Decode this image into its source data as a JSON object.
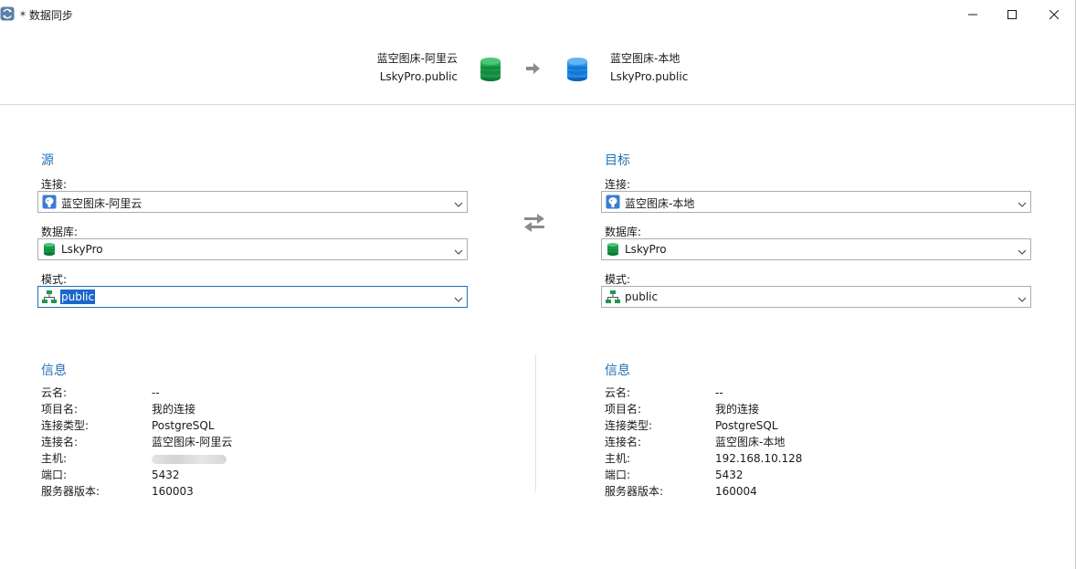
{
  "window": {
    "title": "* 数据同步"
  },
  "banner": {
    "source_line1": "蓝空图床-阿里云",
    "source_line2": "LskyPro.public",
    "target_line1": "蓝空图床-本地",
    "target_line2": "LskyPro.public"
  },
  "source": {
    "title": "源",
    "connection_label": "连接:",
    "connection_value": "蓝空图床-阿里云",
    "database_label": "数据库:",
    "database_value": "LskyPro",
    "schema_label": "模式:",
    "schema_value": "public"
  },
  "target": {
    "title": "目标",
    "connection_label": "连接:",
    "connection_value": "蓝空图床-本地",
    "database_label": "数据库:",
    "database_value": "LskyPro",
    "schema_label": "模式:",
    "schema_value": "public"
  },
  "source_info": {
    "title": "信息",
    "rows": [
      {
        "label": "云名:",
        "value": "--"
      },
      {
        "label": "项目名:",
        "value": "我的连接"
      },
      {
        "label": "连接类型:",
        "value": "PostgreSQL"
      },
      {
        "label": "连接名:",
        "value": "蓝空图床-阿里云"
      },
      {
        "label": "主机:",
        "value": ""
      },
      {
        "label": "端口:",
        "value": "5432"
      },
      {
        "label": "服务器版本:",
        "value": "160003"
      }
    ]
  },
  "target_info": {
    "title": "信息",
    "rows": [
      {
        "label": "云名:",
        "value": "--"
      },
      {
        "label": "项目名:",
        "value": "我的连接"
      },
      {
        "label": "连接类型:",
        "value": "PostgreSQL"
      },
      {
        "label": "连接名:",
        "value": "蓝空图床-本地"
      },
      {
        "label": "主机:",
        "value": "192.168.10.128"
      },
      {
        "label": "端口:",
        "value": "5432"
      },
      {
        "label": "服务器版本:",
        "value": "160004"
      }
    ]
  },
  "colors": {
    "accent": "#1f6fb3",
    "selection": "#1a67c9",
    "source_db": "#1a9a4a",
    "target_db": "#1e88e5"
  },
  "icons": {
    "app": "data-sync-icon",
    "minimize": "minimize-icon",
    "maximize": "maximize-icon",
    "close": "close-icon",
    "arrow": "arrow-right-icon",
    "swap": "swap-icon",
    "connection": "postgresql-elephant-icon",
    "database": "database-icon",
    "schema": "schema-icon",
    "dropdown": "chevron-down-icon"
  }
}
